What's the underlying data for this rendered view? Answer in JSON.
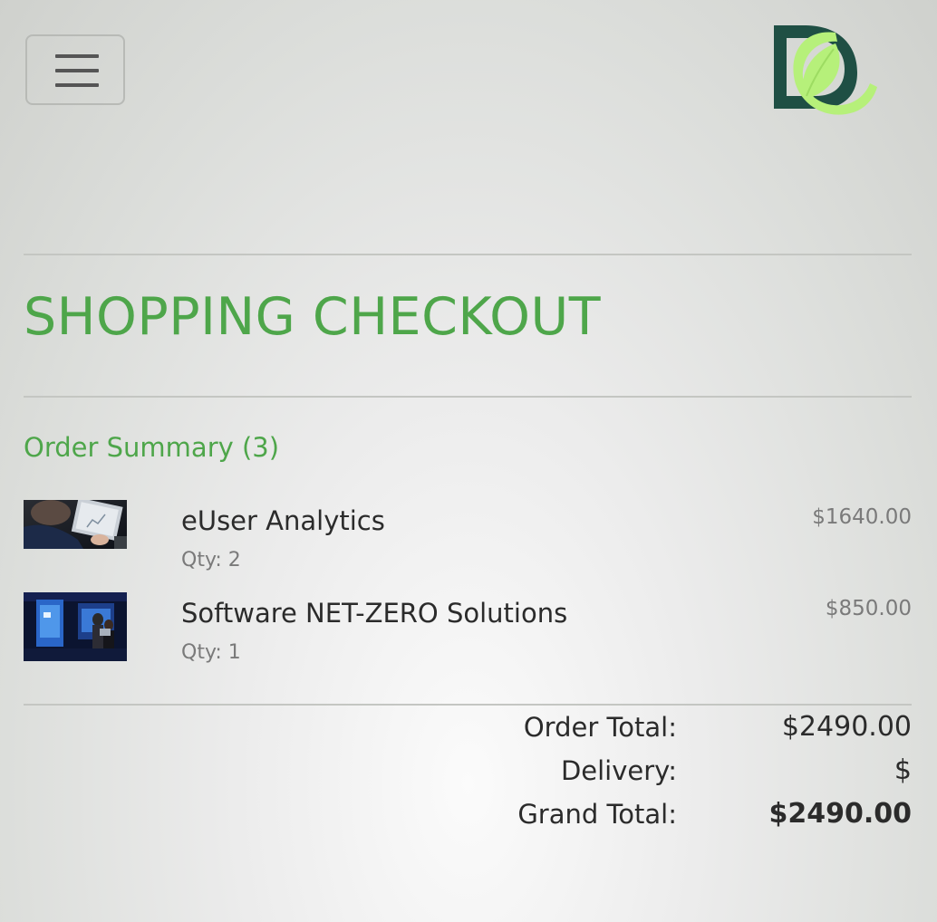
{
  "header": {
    "menu_icon": "hamburger-menu-icon",
    "logo_icon": "dc-leaf-logo",
    "brand_colors": {
      "logo_dark": "#1f4f44",
      "logo_light": "#b6f07a",
      "accent_green": "#4ea64a"
    }
  },
  "page": {
    "title": "SHOPPING CHECKOUT"
  },
  "order_summary": {
    "title": "Order Summary (3)",
    "items": [
      {
        "name": "eUser Analytics",
        "qty": "Qty: 2",
        "price": "$1640.00",
        "thumbnail": "person-using-tablet-photo"
      },
      {
        "name": "Software NET-ZERO Solutions",
        "qty": "Qty: 1",
        "price": "$850.00",
        "thumbnail": "people-at-display-screen-photo"
      }
    ]
  },
  "totals": {
    "order_total_label": "Order Total:",
    "order_total_value": "$2490.00",
    "delivery_label": "Delivery:",
    "delivery_value": "$",
    "grand_total_label": "Grand Total:",
    "grand_total_value": "$2490.00"
  }
}
